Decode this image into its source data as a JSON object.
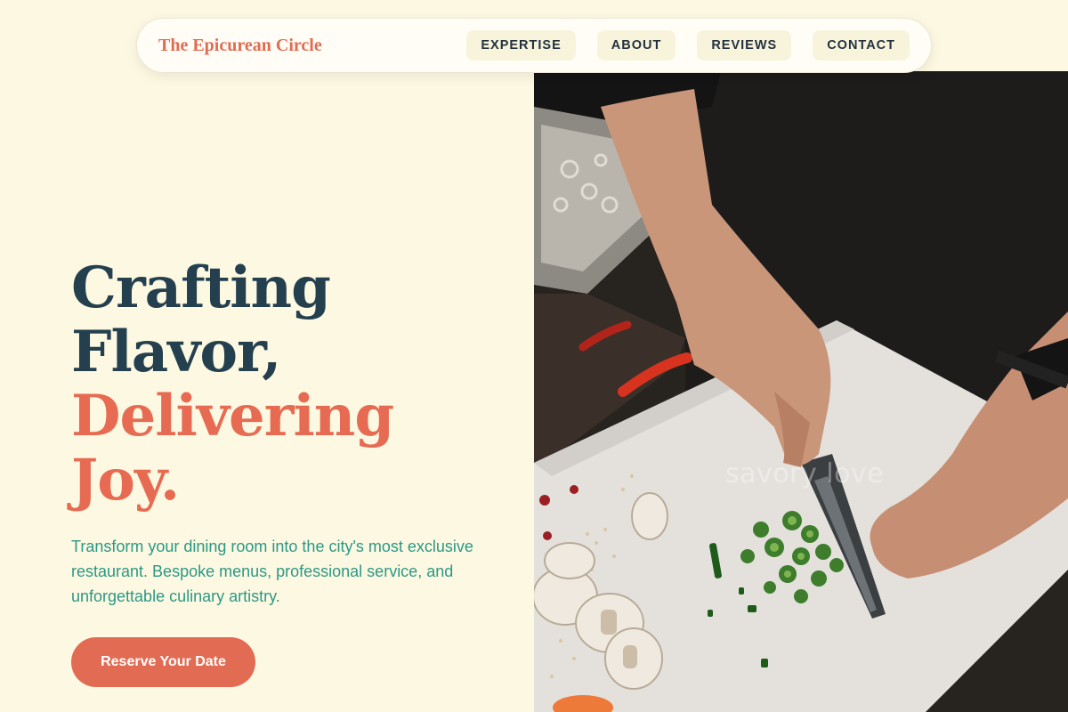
{
  "brand": {
    "name": "The Epicurean Circle"
  },
  "nav": {
    "links": [
      "EXPERTISE",
      "ABOUT",
      "REVIEWS",
      "CONTACT"
    ]
  },
  "hero": {
    "headline_line1": "Crafting",
    "headline_line2": "Flavor,",
    "headline_line3": "Delivering",
    "headline_line4": "Joy.",
    "description": "Transform your dining room into the city's most exclusive restaurant. Bespoke menus, professional service, and unforgettable culinary artistry.",
    "cta_label": "Reserve Your Date",
    "image_watermark": "savory love"
  },
  "colors": {
    "background": "#fdf8e1",
    "brand_accent": "#e06c52",
    "headline_dark": "#24404f",
    "body_teal": "#2b9887",
    "cta": "#e26c53"
  }
}
